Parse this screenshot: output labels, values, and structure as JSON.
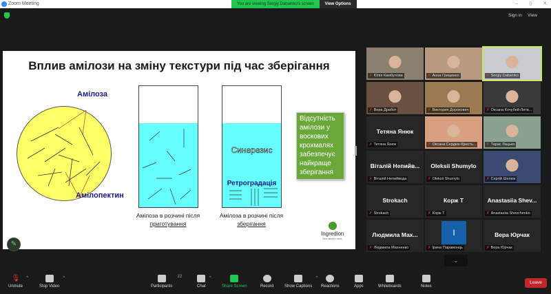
{
  "window": {
    "title": "Zoom Meeting",
    "banner": "You are viewing Sergiy Datsenko's screen",
    "view_options": "View Options",
    "minimize": "–",
    "maximize": "▯",
    "close": "✕"
  },
  "topbar": {
    "sign_in": "Sign in",
    "view": "View"
  },
  "slide": {
    "title": "Вплив амілози на зміну текстури під час зберігання",
    "amylose": "Амілоза",
    "amylopectin": "Амілопектин",
    "beaker1_caption": "Амілоза в розчині після",
    "beaker1_caption_u": "приготування",
    "beaker2_caption": "Амілоза в розчині після",
    "beaker2_caption_u": "зберігання",
    "syneresis": "Синерезис",
    "retrogradation": "Ретроградація",
    "green_box": "Відсутність амілози у воскових крохмалях забезпечує найкраще зберігання",
    "logo": "Ingredion",
    "logo_tag": "See what's next."
  },
  "participants": [
    {
      "label": "Юлія Камбулова",
      "video": "#8a8070"
    },
    {
      "label": "Анна Грищенко",
      "video": "#b89a80"
    },
    {
      "label": "Sergiy Datsenko",
      "video": "#c8ccd0",
      "active": true
    },
    {
      "label": "Вера Дработ",
      "video": "#6a5040"
    },
    {
      "label": "Виктория Дорохович",
      "video": "#9a7a50"
    },
    {
      "label": "Оксана Кочубей-Литв...",
      "video": "#3a3a3a"
    },
    {
      "name": "Тетяна Янюк",
      "label": "Тетяна Янюк"
    },
    {
      "label": "Оксана Сердюк-Кресть...",
      "video": "#d8a080"
    },
    {
      "label": "Тарас Лацько",
      "video": "#8aa090"
    },
    {
      "name": "Віталій Непийв...",
      "label": "Віталій Непийвода"
    },
    {
      "name": "Oleksii Shumylo",
      "label": "Oleksii Shumylo"
    },
    {
      "label": "Сергій Шелюк",
      "video": "#3a4a70"
    },
    {
      "name": "Strokach",
      "label": "Strokach"
    },
    {
      "name": "Корж Т",
      "label": "Корж Т"
    },
    {
      "name": "Anastasiia Shev...",
      "label": "Anastasiia Shevchenko"
    },
    {
      "name": "Людмила Мах...",
      "label": "Людмила Махненко"
    },
    {
      "name": "I",
      "label": "Ірина Парамонць",
      "avatar": "#1560a8"
    },
    {
      "name": "Вера Юрчак",
      "label": "Вера Юрчак"
    }
  ],
  "toolbar": {
    "unmute": "Unmute",
    "stop_video": "Stop Video",
    "participants": "Participants",
    "participant_count": "22",
    "chat": "Chat",
    "share": "Share Screen",
    "record": "Record",
    "captions": "Show Captions",
    "reactions": "Reactions",
    "apps": "Apps",
    "whiteboards": "Whiteboards",
    "notes": "Notes",
    "leave": "Leave"
  }
}
